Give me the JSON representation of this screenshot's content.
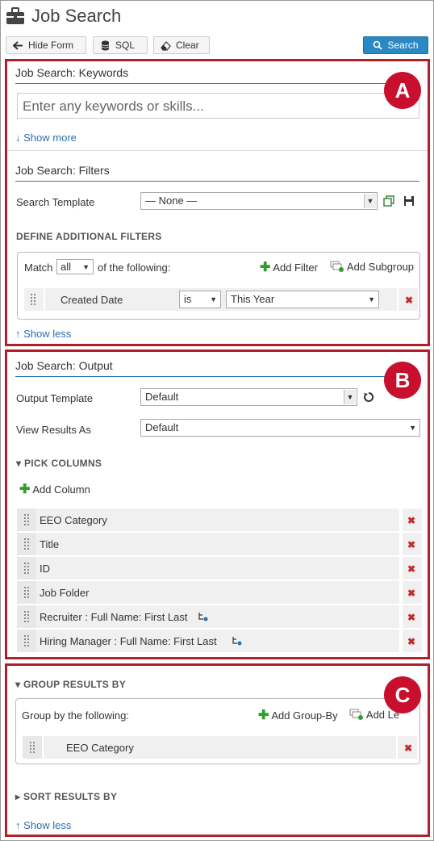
{
  "header": {
    "title": "Job Search"
  },
  "toolbar": {
    "hide_form": "Hide Form",
    "sql": "SQL",
    "clear": "Clear",
    "search": "Search"
  },
  "badges": {
    "a": "A",
    "b": "B",
    "c": "C"
  },
  "keywords": {
    "heading": "Job Search: Keywords",
    "placeholder": "Enter any keywords or skills...",
    "show_more": "Show more"
  },
  "filters": {
    "heading": "Job Search: Filters",
    "template_label": "Search Template",
    "template_value": "— None —",
    "define_label": "DEFINE ADDITIONAL FILTERS",
    "match_label": "Match",
    "match_value": "all",
    "of_following": "of the following:",
    "add_filter": "Add Filter",
    "add_subgroup": "Add Subgroup",
    "rows": [
      {
        "field": "Created Date",
        "operator": "is",
        "value": "This Year"
      }
    ],
    "show_less": "Show less"
  },
  "output": {
    "heading": "Job Search: Output",
    "template_label": "Output Template",
    "template_value": "Default",
    "view_label": "View Results As",
    "view_value": "Default",
    "pick_columns": "PICK COLUMNS",
    "add_column": "Add Column",
    "columns": [
      "EEO Category",
      "Title",
      "ID",
      "Job Folder",
      "Recruiter : Full Name: First Last",
      "Hiring Manager : Full Name: First Last"
    ]
  },
  "grouping": {
    "group_results_by": "GROUP RESULTS BY",
    "group_by_following": "Group by the following:",
    "add_group_by": "Add Group-By",
    "add_level": "Add Le",
    "group_rows": [
      "EEO Category"
    ],
    "sort_results_by": "SORT RESULTS BY",
    "show_less": "Show less"
  },
  "colors": {
    "accent": "#2a88c2",
    "highlight_border": "#b01f2a",
    "badge": "#c8102e",
    "delete": "#c62828",
    "add": "#2e9e2e"
  }
}
